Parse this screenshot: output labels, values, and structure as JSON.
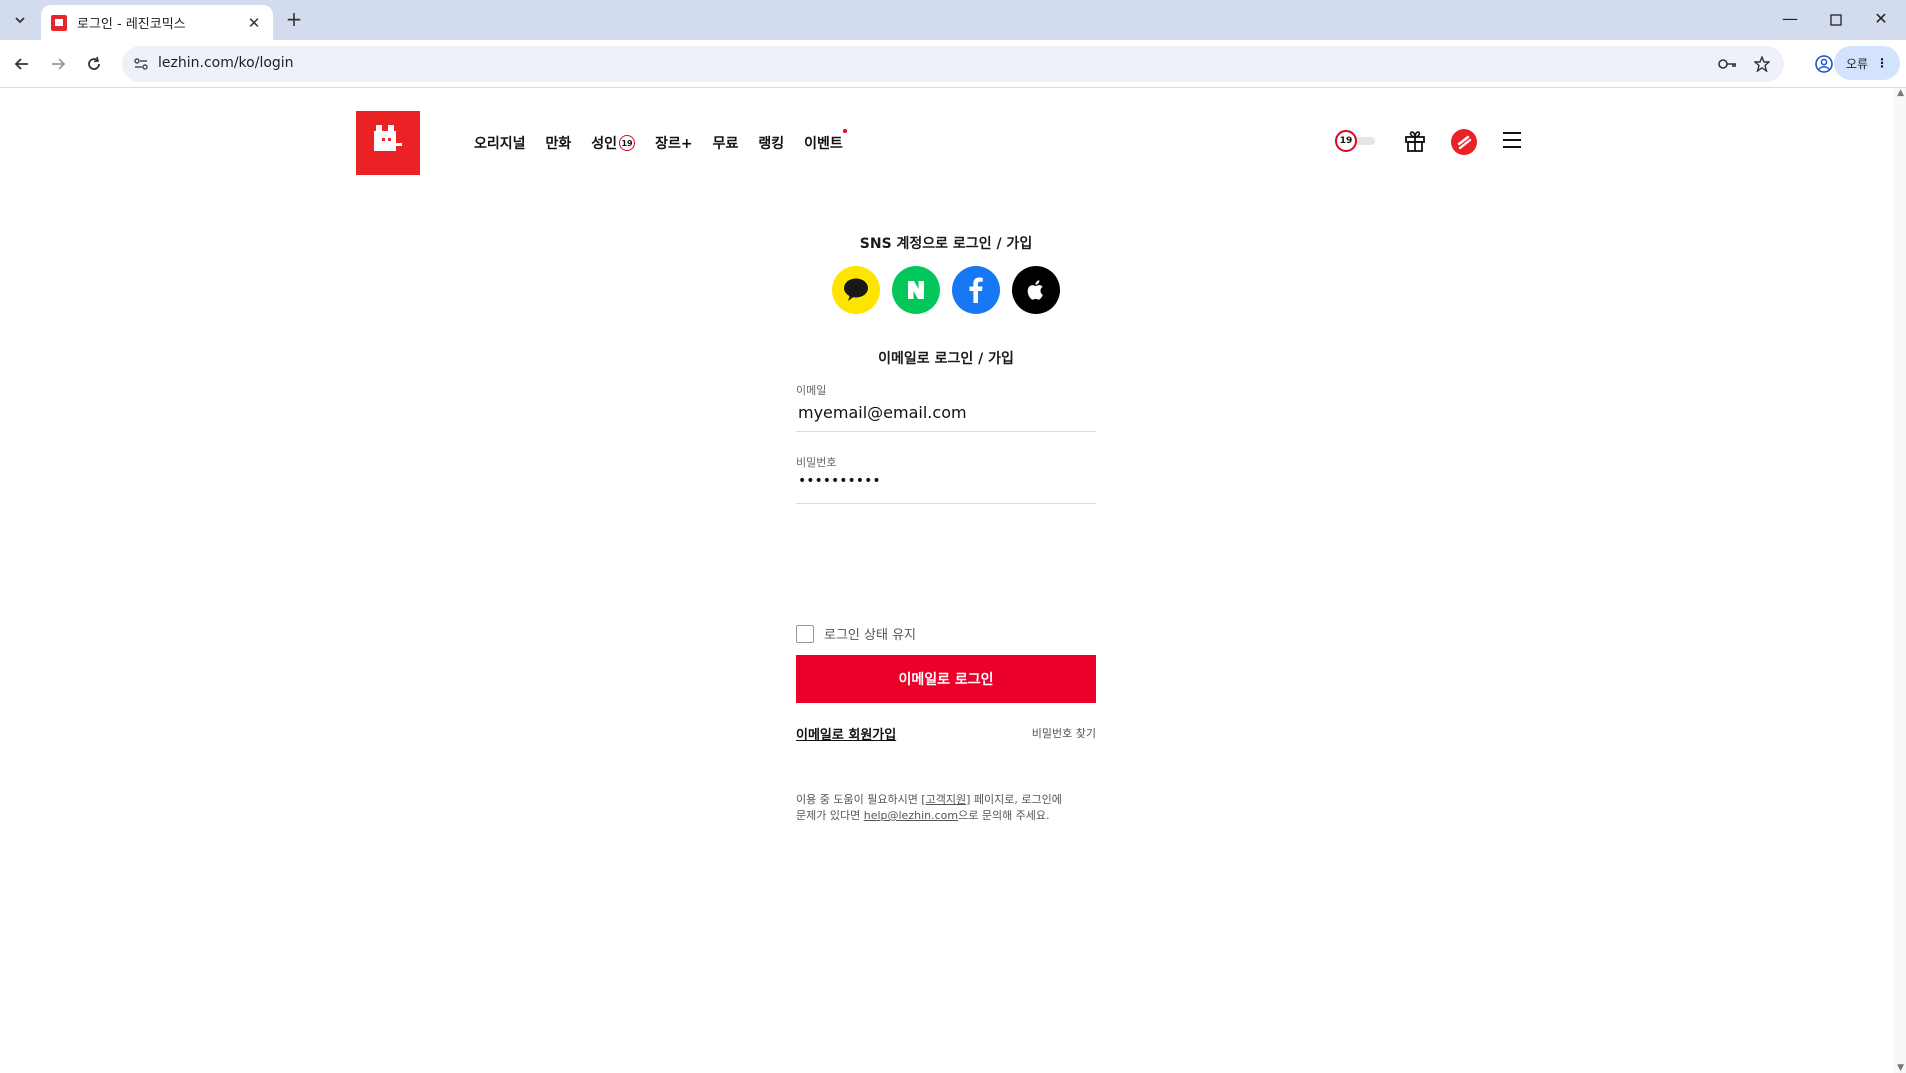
{
  "browser": {
    "tab_title": "로그인 - 레진코믹스",
    "url": "lezhin.com/ko/login",
    "profile_chip": "오류"
  },
  "header": {
    "nav": [
      "오리지널",
      "만화",
      "성인",
      "장르+",
      "무료",
      "랭킹",
      "이벤트"
    ],
    "adult_badge": "19",
    "toggle_badge": "19"
  },
  "login": {
    "sns_title": "SNS 계정으로 로그인 / 가입",
    "sns_providers": [
      "kakao",
      "naver",
      "facebook",
      "apple"
    ],
    "email_title": "이메일로 로그인 / 가입",
    "email_label": "이메일",
    "email_value": "myemail@email.com",
    "password_label": "비밀번호",
    "password_value": "••••••••••",
    "keep_logged_in": "로그인 상태 유지",
    "login_button": "이메일로 로그인",
    "signup_link": "이메일로 회원가입",
    "find_password": "비밀번호 찾기",
    "help_prefix": "이용 중 도움이 필요하시면 [",
    "help_link": "고객지원",
    "help_middle": "] 페이지로, 로그인에",
    "help_line2_prefix": "문제가 있다면 ",
    "help_email": "help@lezhin.com",
    "help_suffix": "으로 문의해 주세요."
  },
  "colors": {
    "brand": "#ea2226",
    "login_button": "#ea0029",
    "kakao": "#fee500",
    "naver": "#03c75a",
    "facebook": "#1877f2",
    "apple": "#000000"
  }
}
